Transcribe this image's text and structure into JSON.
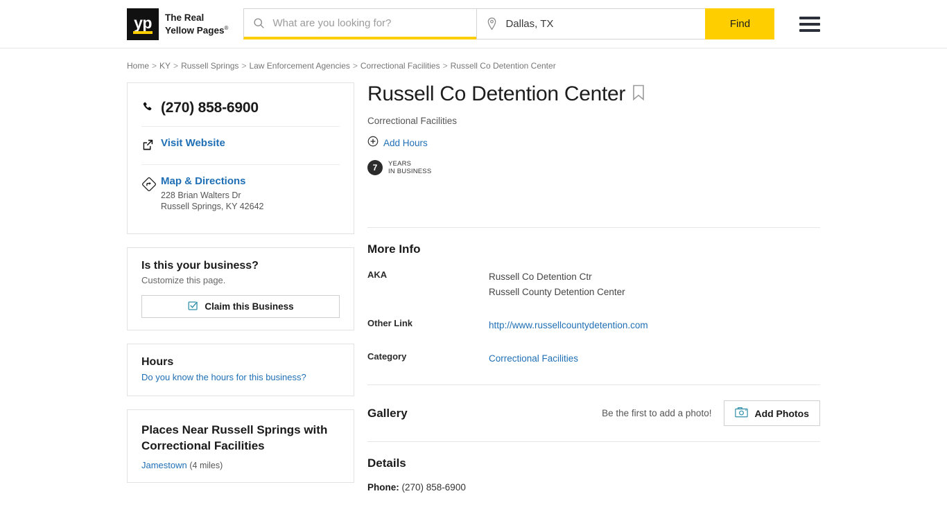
{
  "header": {
    "logo": {
      "mark_text": "yp",
      "line1": "The Real",
      "line2": "Yellow Pages",
      "trademark": "®"
    },
    "search": {
      "what_placeholder": "What are you looking for?",
      "what_value": "",
      "where_value": "Dallas, TX",
      "find_label": "Find"
    },
    "menu_icon": "hamburger-menu-icon"
  },
  "breadcrumb": [
    "Home",
    "KY",
    "Russell Springs",
    "Law Enforcement Agencies",
    "Correctional Facilities",
    "Russell Co Detention Center"
  ],
  "breadcrumb_separator": ">",
  "sidebar": {
    "contact": {
      "phone": "(270) 858-6900",
      "phone_icon": "phone-icon",
      "website_label": "Visit Website",
      "website_icon": "external-link-icon",
      "directions_label": "Map & Directions",
      "directions_icon": "directions-diamond-icon",
      "address_line1": "228 Brian Walters Dr",
      "address_line2": "Russell Springs, KY 42642"
    },
    "claim": {
      "title": "Is this your business?",
      "subtitle": "Customize this page.",
      "button_label": "Claim this Business",
      "button_icon": "checkbox-check-icon"
    },
    "hours": {
      "title": "Hours",
      "link": "Do you know the hours for this business?"
    },
    "places_near": {
      "title": "Places Near Russell Springs with Correctional Facilities",
      "items": [
        {
          "name": "Jamestown",
          "distance": "(4 miles)"
        }
      ]
    }
  },
  "main": {
    "title": "Russell Co Detention Center",
    "save_icon": "bookmark-icon",
    "category": "Correctional Facilities",
    "add_hours": {
      "label": "Add Hours",
      "icon": "plus-circle-icon"
    },
    "years_in_business": {
      "number": "7",
      "line1": "YEARS",
      "line2": "IN BUSINESS"
    },
    "more_info": {
      "title": "More Info",
      "rows": [
        {
          "label": "AKA",
          "values": [
            "Russell Co Detention Ctr",
            "Russell County Detention Center"
          ],
          "is_link": false
        },
        {
          "label": "Other Link",
          "values": [
            "http://www.russellcountydetention.com"
          ],
          "is_link": true
        },
        {
          "label": "Category",
          "values": [
            "Correctional Facilities"
          ],
          "is_link": true
        }
      ]
    },
    "gallery": {
      "title": "Gallery",
      "empty_text": "Be the first to add a photo!",
      "add_photos_label": "Add Photos",
      "add_photos_icon": "camera-icon"
    },
    "details": {
      "title": "Details",
      "phone_label": "Phone:",
      "phone_value": "(270) 858-6900"
    }
  },
  "colors": {
    "brand_yellow": "#ffce00",
    "link_blue": "#1f6fb5",
    "teal_icon": "#2e8fa8",
    "text_dark": "#1a1a1a"
  }
}
